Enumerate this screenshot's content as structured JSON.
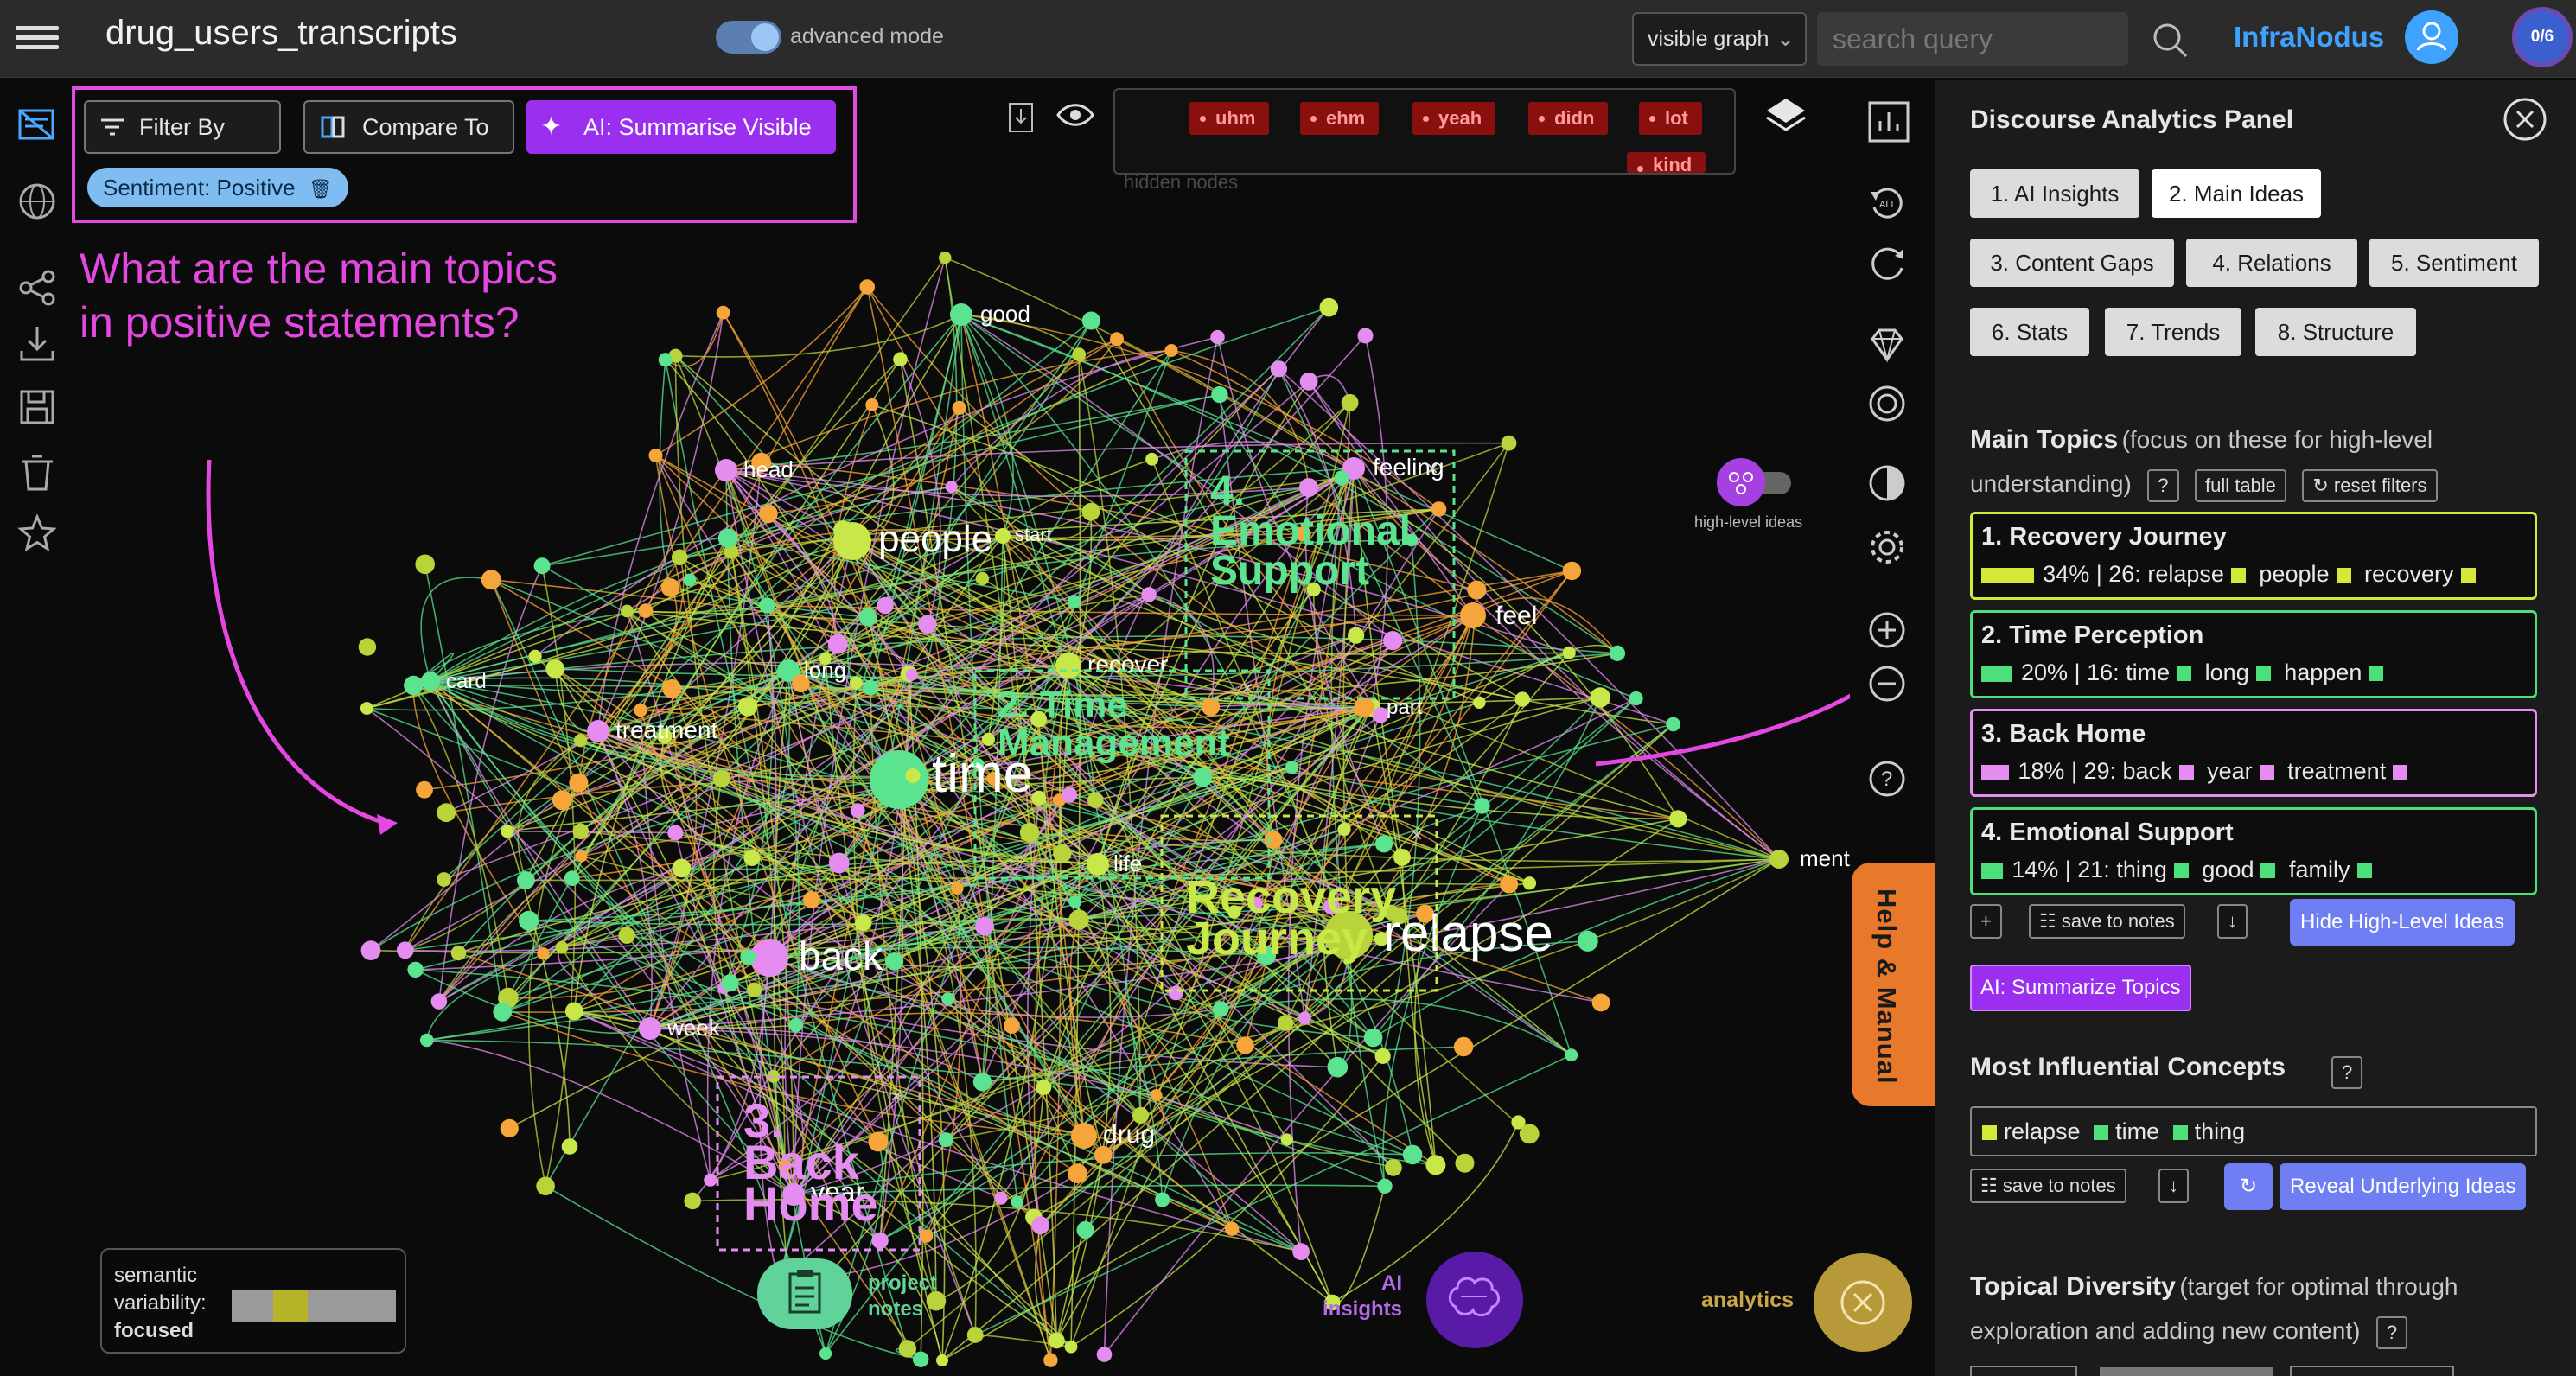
{
  "app": {
    "title": "drug_users_transcripts",
    "advanced_mode_label": "advanced mode",
    "graph_select": "visible graph",
    "search_placeholder": "search query",
    "brand": "InfraNodus",
    "counter": "0/6"
  },
  "toolbar": {
    "filter_by": "Filter By",
    "compare_to": "Compare To",
    "ai_summarise": "AI: Summarise Visible",
    "sentiment_chip": "Sentiment: Positive"
  },
  "annotation": {
    "question_line1": "What are the main topics",
    "question_line2": "in positive statements?"
  },
  "hidden_nodes": {
    "label": "hidden nodes",
    "items": [
      "uhm",
      "ehm",
      "yeah",
      "didn",
      "lot",
      "kind"
    ]
  },
  "graph": {
    "nodes": [
      {
        "label": "time",
        "color": "#5be38f"
      },
      {
        "label": "relapse",
        "color": "#b8d43a"
      },
      {
        "label": "back",
        "color": "#e58cf0"
      },
      {
        "label": "people",
        "color": "#c8e84a"
      },
      {
        "label": "good",
        "color": "#5be38f"
      },
      {
        "label": "head",
        "color": "#e58cf0"
      },
      {
        "label": "feeling",
        "color": "#e58cf0"
      },
      {
        "label": "start",
        "color": "#c8e84a"
      },
      {
        "label": "feel",
        "color": "#f5a53a"
      },
      {
        "label": "card",
        "color": "#5be38f"
      },
      {
        "label": "long",
        "color": "#5be38f"
      },
      {
        "label": "recover",
        "color": "#c8e84a"
      },
      {
        "label": "treatment",
        "color": "#e58cf0"
      },
      {
        "label": "part",
        "color": "#c8e84a"
      },
      {
        "label": "life",
        "color": "#c8e84a"
      },
      {
        "label": "week",
        "color": "#e58cf0"
      },
      {
        "label": "drug",
        "color": "#f5a53a"
      },
      {
        "label": "year",
        "color": "#e58cf0"
      },
      {
        "label": "mental",
        "color": "#b8d43a"
      }
    ],
    "clusters": [
      {
        "line1": "4.",
        "line2": "Emotional",
        "line3": "Support",
        "color": "#5be38f"
      },
      {
        "line1": "2. Time",
        "line2": "Management",
        "color": "#5be38f"
      },
      {
        "line1": "Recovery",
        "line2": "Journey",
        "color": "#c8e84a"
      },
      {
        "line1": "3.",
        "line2": "Back",
        "line3": "Home",
        "color": "#e58cf0"
      }
    ]
  },
  "controls": {
    "high_level_ideas": "high-level ideas",
    "help_manual": "Help & Manual",
    "variability_label1": "semantic",
    "variability_label2": "variability:",
    "variability_value": "focused",
    "project_notes_1": "project",
    "project_notes_2": "notes",
    "ai_insights_1": "AI",
    "ai_insights_2": "insights",
    "analytics": "analytics"
  },
  "panel": {
    "title": "Discourse Analytics Panel",
    "tabs": [
      "1. AI Insights",
      "2. Main Ideas",
      "3. Content Gaps",
      "4. Relations",
      "5. Sentiment",
      "6. Stats",
      "7. Trends",
      "8. Structure"
    ],
    "main_topics_title": "Main Topics",
    "main_topics_sub1": "(focus on these for high-level",
    "main_topics_sub2": "understanding)",
    "help_q": "?",
    "full_table": "full table",
    "reset_filters": "↻ reset filters",
    "topics": [
      {
        "name": "1. Recovery Journey",
        "pct": 34,
        "pct_text": "34%",
        "count": "26:",
        "words": [
          "relapse",
          "people",
          "recovery"
        ],
        "color": "#d4e83a"
      },
      {
        "name": "2. Time Perception",
        "pct": 20,
        "pct_text": "20%",
        "count": "16:",
        "words": [
          "time",
          "long",
          "happen"
        ],
        "color": "#4be07a"
      },
      {
        "name": "3. Back Home",
        "pct": 18,
        "pct_text": "18%",
        "count": "29:",
        "words": [
          "back",
          "year",
          "treatment"
        ],
        "color": "#e58cf0"
      },
      {
        "name": "4. Emotional Support",
        "pct": 14,
        "pct_text": "14%",
        "count": "21:",
        "words": [
          "thing",
          "good",
          "family"
        ],
        "color": "#4be07a"
      }
    ],
    "plus": "+",
    "save_to_notes": "save to notes",
    "download": "↓",
    "hide_high_level": "Hide High-Level Ideas",
    "ai_summarize_topics": "AI: Summarize Topics",
    "influential_title": "Most Influential Concepts",
    "influential": [
      {
        "word": "relapse",
        "color": "#d4e83a"
      },
      {
        "word": "time",
        "color": "#4be07a"
      },
      {
        "word": "thing",
        "color": "#4be07a"
      }
    ],
    "refresh": "↻",
    "reveal_underlying": "Reveal Underlying Ideas",
    "diversity_title": "Topical Diversity",
    "diversity_sub1": "(target for optimal through",
    "diversity_sub2": "exploration and adding new content)"
  }
}
